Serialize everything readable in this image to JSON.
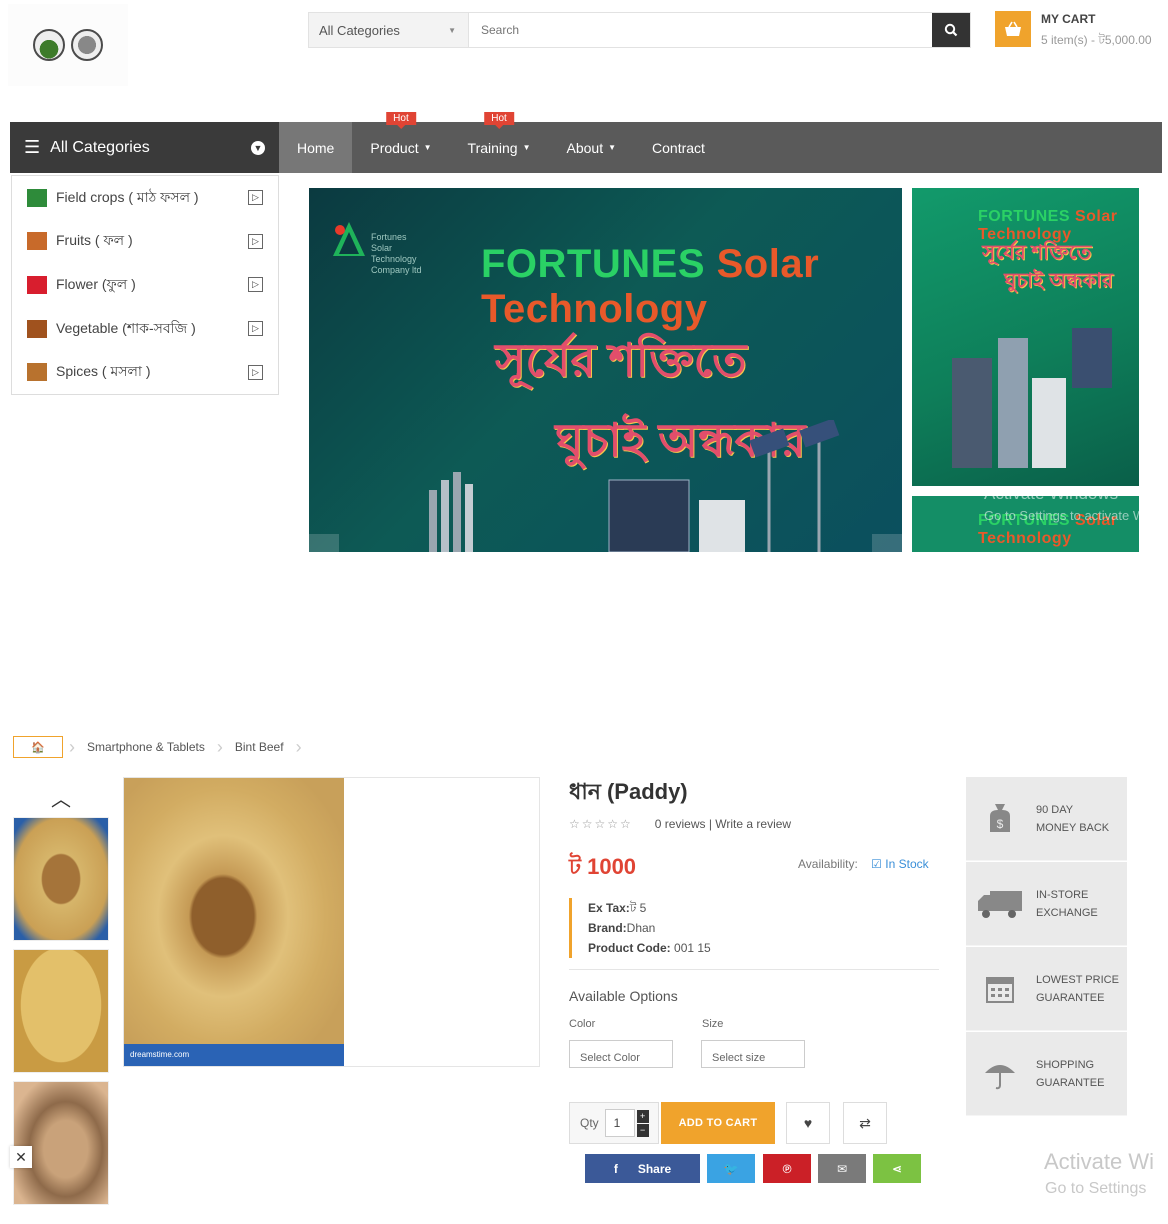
{
  "header": {
    "category_select": "All Categories",
    "search_placeholder": "Search",
    "cart_title": "MY CART",
    "cart_summary": "5 item(s) - ট5,000.00"
  },
  "nav": {
    "all_categories": "All Categories",
    "items": [
      {
        "label": "Home",
        "badge": ""
      },
      {
        "label": "Product",
        "badge": "Hot"
      },
      {
        "label": "Training",
        "badge": "Hot"
      },
      {
        "label": "About",
        "badge": ""
      },
      {
        "label": "Contract",
        "badge": ""
      }
    ]
  },
  "categories": [
    {
      "label": "Field crops ( মাঠ ফসল )",
      "color": "#2e8b3a"
    },
    {
      "label": "Fruits ( ফল )",
      "color": "#c86a2a"
    },
    {
      "label": "Flower (ফুল )",
      "color": "#d81e2e"
    },
    {
      "label": "Vegetable (শাক-সবজি )",
      "color": "#a0521e"
    },
    {
      "label": "Spices ( মসলা )",
      "color": "#b8722e"
    }
  ],
  "banner": {
    "word1": "FORTUNES",
    "word2": "Solar Technology",
    "line1": "সূর্যের শক্তিতে",
    "line2": "ঘুচাই অন্ধকার",
    "company": "Fortunes Solar Technology Company ltd"
  },
  "os_watermark": {
    "title": "Activate Windows",
    "sub": "Go to Settings to activate W",
    "title2": "Activate Wi",
    "sub2": "Go to Settings"
  },
  "breadcrumb": [
    "Smartphone & Tablets",
    "Bint Beef"
  ],
  "product": {
    "title": "ধান (Paddy)",
    "reviews": "0 reviews",
    "write_review": "Write a review",
    "price": "ট 1000",
    "availability_label": "Availability:",
    "availability_value": "In Stock",
    "ex_tax_label": "Ex Tax:",
    "ex_tax_value": "ট 5",
    "brand_label": "Brand:",
    "brand_value": "Dhan",
    "code_label": "Product Code:",
    "code_value": "001 15",
    "options_title": "Available Options",
    "color_label": "Color",
    "color_placeholder": "Select Color",
    "size_label": "Size",
    "size_placeholder": "Select size",
    "qty_label": "Qty",
    "qty_value": "1",
    "add_to_cart": "ADD TO CART",
    "share_label": "Share",
    "image_watermark": "dreamstime.com"
  },
  "guarantees": [
    {
      "line1": "90 DAY",
      "line2": "MONEY BACK",
      "icon": "money-bag-icon"
    },
    {
      "line1": "IN-STORE",
      "line2": "EXCHANGE",
      "icon": "truck-icon"
    },
    {
      "line1": "LOWEST PRICE",
      "line2": "GUARANTEE",
      "icon": "calendar-icon"
    },
    {
      "line1": "SHOPPING",
      "line2": "GUARANTEE",
      "icon": "umbrella-icon"
    }
  ],
  "colors": {
    "accent": "#f0a32c",
    "hot": "#e04434",
    "facebook": "#3b5998",
    "twitter": "#3aa3e3",
    "pinterest": "#cb2027",
    "email": "#7a7a7a",
    "sharethis": "#7cc242"
  }
}
